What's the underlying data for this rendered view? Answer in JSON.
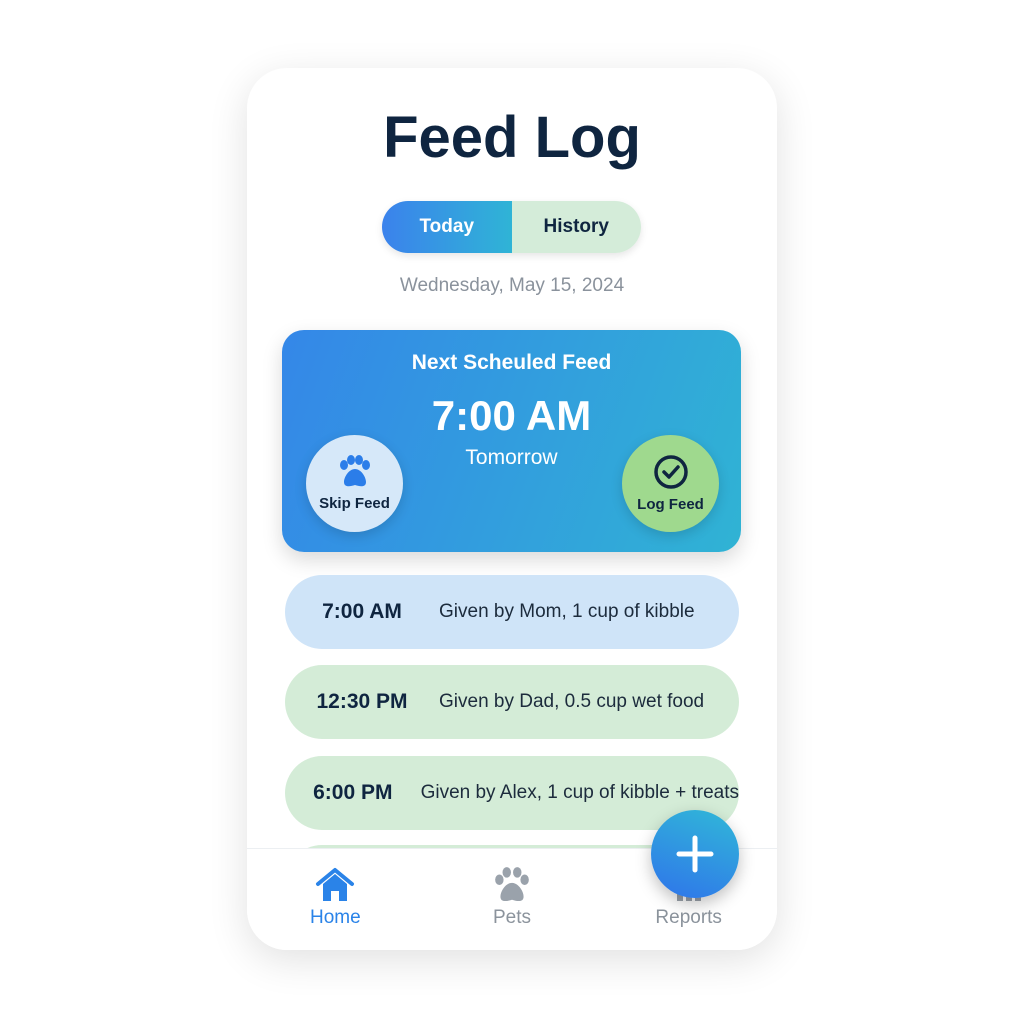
{
  "header": {
    "title": "Feed Log"
  },
  "tabs": [
    {
      "label": "Today",
      "active": true
    },
    {
      "label": "History",
      "active": false
    }
  ],
  "date": "Wednesday, May 15, 2024",
  "next_feed": {
    "heading": "Next Scheuled Feed",
    "time": "7:00 AM",
    "day": "Tomorrow",
    "skip_label": "Skip Feed",
    "log_label": "Log Feed"
  },
  "entries": [
    {
      "time": "7:00 AM",
      "desc": "Given by Mom, 1 cup of kibble",
      "color": "#cfe4f8"
    },
    {
      "time": "12:30 PM",
      "desc": "Given by Dad, 0.5 cup wet food",
      "color": "#d4ecd7"
    },
    {
      "time": "6:00 PM",
      "desc": "Given by Alex, 1 cup of kibble + treats",
      "color": "#d4ecd7"
    }
  ],
  "nav": [
    {
      "label": "Home",
      "icon": "home-icon",
      "active": true
    },
    {
      "label": "Pets",
      "icon": "paw-icon"
    },
    {
      "label": "Reports",
      "icon": "chart-icon"
    }
  ],
  "fab": {
    "icon": "plus-icon"
  }
}
